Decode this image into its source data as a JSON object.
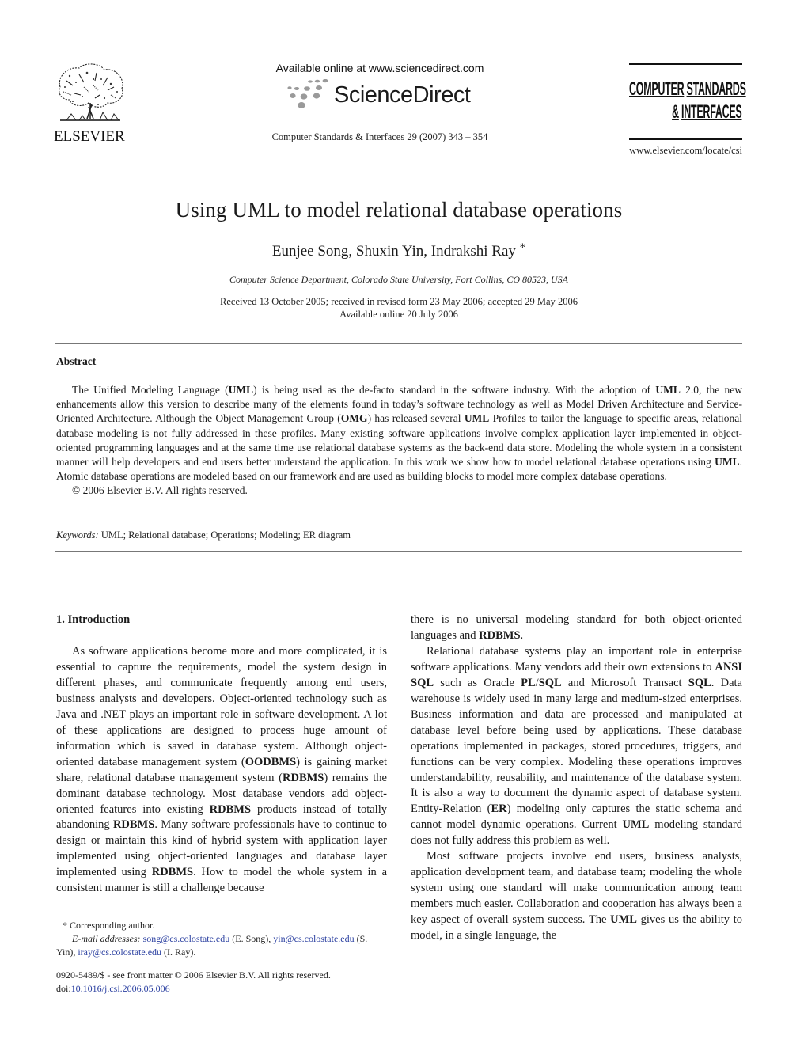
{
  "header": {
    "publisher_name": "ELSEVIER",
    "available_online": "Available online at www.sciencedirect.com",
    "sciencedirect_brand": "ScienceDirect",
    "journal_reference": "Computer Standards & Interfaces 29 (2007) 343 – 354",
    "journal_logo": {
      "line1_a": "COMPUTER",
      "line1_b": "STANDARDS",
      "line2_a": "&",
      "line2_b": "INTERFACES"
    },
    "journal_url": "www.elsevier.com/locate/csi"
  },
  "paper": {
    "title": "Using UML to model relational database operations",
    "authors": "Eunjee Song, Shuxin Yin, Indrakshi Ray",
    "corresponding_marker": "*",
    "affiliation": "Computer Science Department, Colorado State University, Fort Collins, CO 80523, USA",
    "received": "Received 13 October 2005; received in revised form 23 May 2006; accepted 29 May 2006",
    "available": "Available online 20 July 2006"
  },
  "abstract": {
    "heading": "Abstract",
    "segments": [
      {
        "t": "The Unified Modeling Language ("
      },
      {
        "t": "UML",
        "b": true
      },
      {
        "t": ") is being used as the de-facto standard in the software industry. With the adoption of "
      },
      {
        "t": "UML",
        "b": true
      },
      {
        "t": " 2.0, the new enhancements allow this version to describe many of the elements found in today’s software technology as well as Model Driven Architecture and Service-Oriented Architecture. Although the Object Management Group ("
      },
      {
        "t": "OMG",
        "b": true
      },
      {
        "t": ") has released several "
      },
      {
        "t": "UML",
        "b": true
      },
      {
        "t": " Profiles to tailor the language to specific areas, relational database modeling is not fully addressed in these profiles. Many existing software applications involve complex application layer implemented in object-oriented programming languages and at the same time use relational database systems as the back-end data store. Modeling the whole system in a consistent manner will help developers and end users better understand the application. In this work we show how to model relational database operations using "
      },
      {
        "t": "UML",
        "b": true
      },
      {
        "t": ". Atomic database operations are modeled based on our framework and are used as building blocks to model more complex database operations."
      }
    ],
    "copyright": "© 2006 Elsevier B.V. All rights reserved."
  },
  "keywords": {
    "label": "Keywords:",
    "value": "UML; Relational database; Operations; Modeling; ER diagram"
  },
  "introduction": {
    "heading": "1.  Introduction",
    "left_column": [
      {
        "t": "As software applications become more and more complicated, it is essential to capture the requirements, model the system design in different phases, and communicate frequently among end users, business analysts and developers. Object-oriented technology such as Java and .NET plays an important role in software development. A lot of these applications are designed to process huge amount of information which is saved in database system. Although object-oriented database management system ("
      },
      {
        "t": "OODBMS",
        "b": true
      },
      {
        "t": ") is gaining market share, relational database management system ("
      },
      {
        "t": "RDBMS",
        "b": true
      },
      {
        "t": ") remains the dominant database technology. Most database vendors add object-oriented features into existing "
      },
      {
        "t": "RDBMS",
        "b": true
      },
      {
        "t": " products instead of totally abandoning "
      },
      {
        "t": "RDBMS",
        "b": true
      },
      {
        "t": ". Many software professionals have to continue to design or maintain this kind of hybrid system with application layer implemented using object-oriented languages and database layer implemented using "
      },
      {
        "t": "RDBMS",
        "b": true
      },
      {
        "t": ". How to model the whole system in a consistent manner is still a challenge because"
      }
    ],
    "right_column": [
      [
        {
          "t": "there is no universal modeling standard for both object-oriented languages and "
        },
        {
          "t": "RDBMS",
          "b": true
        },
        {
          "t": "."
        }
      ],
      [
        {
          "t": "Relational database systems play an important role in enterprise software applications. Many vendors add their own extensions to "
        },
        {
          "t": "ANSI SQL",
          "b": true
        },
        {
          "t": " such as Oracle "
        },
        {
          "t": "PL",
          "b": true
        },
        {
          "t": "/"
        },
        {
          "t": "SQL",
          "b": true
        },
        {
          "t": " and Microsoft Transact "
        },
        {
          "t": "SQL",
          "b": true
        },
        {
          "t": ". Data warehouse is widely used in many large and medium-sized enterprises. Business information and data are processed and manipulated at database level before being used by applications. These database operations implemented in packages, stored procedures, triggers, and functions can be very complex. Modeling these operations improves understandability, reusability, and maintenance of the database system. It is also a way to document the dynamic aspect of database system. Entity-Relation ("
        },
        {
          "t": "ER",
          "b": true
        },
        {
          "t": ") modeling only captures the static schema and cannot model dynamic operations. Current "
        },
        {
          "t": "UML",
          "b": true
        },
        {
          "t": " modeling standard does not fully address this problem as well."
        }
      ],
      [
        {
          "t": "Most software projects involve end users, business analysts, application development team, and database team; modeling the whole system using one standard will make communication among team members much easier. Collaboration and cooperation has always been a key aspect of overall system success. The "
        },
        {
          "t": "UML",
          "b": true
        },
        {
          "t": " gives us the ability to model, in a single language, the"
        }
      ]
    ]
  },
  "footnotes": {
    "corresponding": "* Corresponding author.",
    "email_label": "E-mail addresses:",
    "emails": [
      {
        "address": "song@cs.colostate.edu",
        "who": "(E. Song),"
      },
      {
        "address": "yin@cs.colostate.edu",
        "who": "(S. Yin),"
      },
      {
        "address": "iray@cs.colostate.edu",
        "who": "(I. Ray)."
      }
    ],
    "front_matter": "0920-5489/$ - see front matter © 2006 Elsevier B.V. All rights reserved.",
    "doi_label": "doi:",
    "doi": "10.1016/j.csi.2006.05.006"
  },
  "colors": {
    "link": "#2a3fa0",
    "text": "#1a1a1a",
    "rule": "#777777"
  }
}
